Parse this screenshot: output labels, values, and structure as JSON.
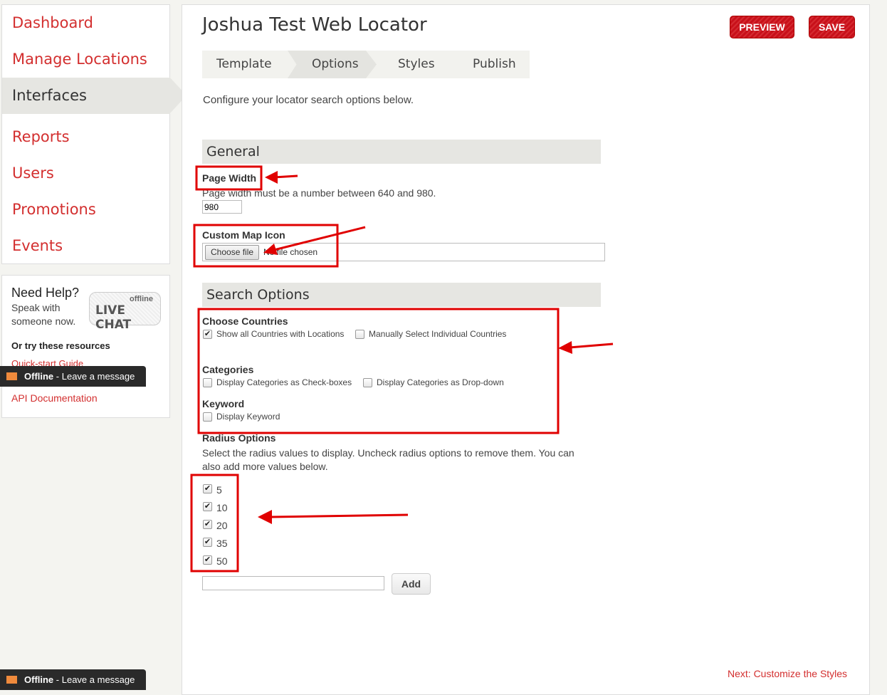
{
  "sidebar": {
    "items": [
      {
        "label": "Dashboard"
      },
      {
        "label": "Manage Locations"
      },
      {
        "label": "Interfaces",
        "active": true
      },
      {
        "label": "Reports"
      },
      {
        "label": "Users"
      },
      {
        "label": "Promotions"
      },
      {
        "label": "Events"
      }
    ]
  },
  "help": {
    "title": "Need Help?",
    "line1": "Speak with",
    "line2": "someone now.",
    "chat_status": "offline",
    "chat_label": "LIVE CHAT",
    "resources_title": "Or try these resources",
    "links": [
      "Quick-start Guide",
      "API Documentation"
    ]
  },
  "offline_bar": {
    "status": "Offline",
    "message": "- Leave a message"
  },
  "header": {
    "title": "Joshua Test Web Locator",
    "preview": "PREVIEW",
    "save": "SAVE"
  },
  "tabs": [
    {
      "label": "Template"
    },
    {
      "label": "Options",
      "active": true
    },
    {
      "label": "Styles"
    },
    {
      "label": "Publish"
    }
  ],
  "intro": "Configure your locator search options below.",
  "general": {
    "title": "General",
    "page_width_label": "Page Width",
    "page_width_help": "Page width must be a number between 640 and 980.",
    "page_width_value": "980",
    "map_icon_label": "Custom Map Icon",
    "choose_file": "Choose file",
    "no_file": "No file chosen"
  },
  "search": {
    "title": "Search Options",
    "countries_label": "Choose Countries",
    "countries_opts": [
      {
        "label": "Show all Countries with Locations",
        "checked": true
      },
      {
        "label": "Manually Select Individual Countries",
        "checked": false
      }
    ],
    "categories_label": "Categories",
    "categories_opts": [
      {
        "label": "Display Categories as Check-boxes",
        "checked": false
      },
      {
        "label": "Display Categories as Drop-down",
        "checked": false
      }
    ],
    "keyword_label": "Keyword",
    "keyword_opt": {
      "label": "Display Keyword",
      "checked": false
    },
    "radius_label": "Radius Options",
    "radius_help1": "Select the radius values to display. Uncheck radius options to remove them. You can",
    "radius_help2": "also add more values below.",
    "radius_values": [
      {
        "label": "5",
        "checked": true
      },
      {
        "label": "10",
        "checked": true
      },
      {
        "label": "20",
        "checked": true
      },
      {
        "label": "35",
        "checked": true
      },
      {
        "label": "50",
        "checked": true
      }
    ],
    "add_value": "",
    "add_button": "Add"
  },
  "next_link": "Next: Customize the Styles",
  "colors": {
    "accent": "#d32f2f",
    "annotation": "#e00000"
  }
}
